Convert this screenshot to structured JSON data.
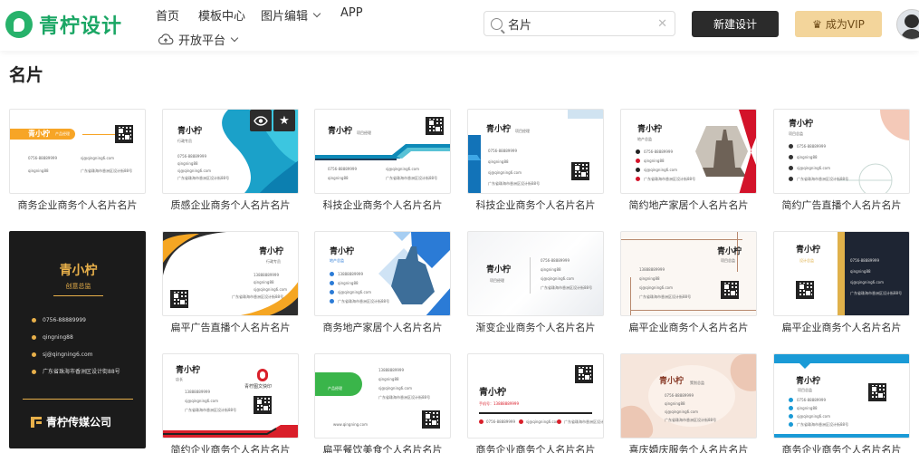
{
  "header": {
    "logo_text": "青柠设计",
    "nav": [
      {
        "label": "首页"
      },
      {
        "label": "模板中心"
      },
      {
        "label": "图片编辑"
      },
      {
        "label": "APP"
      },
      {
        "label": "开放平台"
      }
    ],
    "search": {
      "value": "名片"
    },
    "new_design_label": "新建设计",
    "vip_label": "成为VIP"
  },
  "page_title": "名片",
  "cards": [
    {
      "title": "商务企业商务个人名片名片",
      "name": "青小柠",
      "role": "产品经理"
    },
    {
      "title": "质感企业商务个人名片名片",
      "name": "青小柠",
      "role": "行政专员"
    },
    {
      "title": "科技企业商务个人名片名片",
      "name": "青小柠",
      "role": "项目经理"
    },
    {
      "title": "科技企业商务个人名片名片",
      "name": "青小柠",
      "role": "项目经理"
    },
    {
      "title": "简约地产家居个人名片名片",
      "name": "青小柠",
      "role": "地产总监"
    },
    {
      "title": "简约广告直播个人名片名片",
      "name": "青小柠",
      "role": "项目总监"
    },
    {
      "title": "",
      "name": "青小柠",
      "role": "创意总监"
    },
    {
      "title": "扁平广告直播个人名片名片",
      "name": "青小柠",
      "role": "行政专员"
    },
    {
      "title": "商务地产家居个人名片名片",
      "name": "青小柠",
      "role": "地产总监"
    },
    {
      "title": "渐变企业商务个人名片名片",
      "name": "青小柠",
      "role": "项目经理"
    },
    {
      "title": "扁平企业商务个人名片名片",
      "name": "青小柠",
      "role": "项目总监"
    },
    {
      "title": "扁平企业商务个人名片名片",
      "name": "青小柠",
      "role": "设计总监"
    },
    {
      "title": "简约企业商务个人名片名片",
      "name": "青小柠",
      "role": "店长"
    },
    {
      "title": "扁平餐饮美食个人名片名片",
      "name": "",
      "role": "产品经理"
    },
    {
      "title": "商务企业商务个人名片名片",
      "name": "青小柠",
      "role": ""
    },
    {
      "title": "喜庆婚庆服务个人名片名片",
      "name": "青小柠",
      "role": "策划总监"
    },
    {
      "title": "商务企业商务个人名片名片",
      "name": "青小柠",
      "role": "项目总监"
    }
  ],
  "contact": {
    "phone": "0756-88889999",
    "wechat": "qingning88",
    "email": "sj@qingning6.com",
    "address": "广东省珠海市香洲区设计街88号"
  },
  "tall_card": {
    "company": "青柠传媒公司"
  },
  "card_extras": {
    "phone_short": "13888889999",
    "brand_right": "青柠图文快印",
    "footer_site": "www.qingning.com",
    "red_phone": "手机号：13888889999"
  },
  "colors": {
    "brand": "#1aa664",
    "dark": "#2b2b2b",
    "vip": "#f3d59b"
  }
}
